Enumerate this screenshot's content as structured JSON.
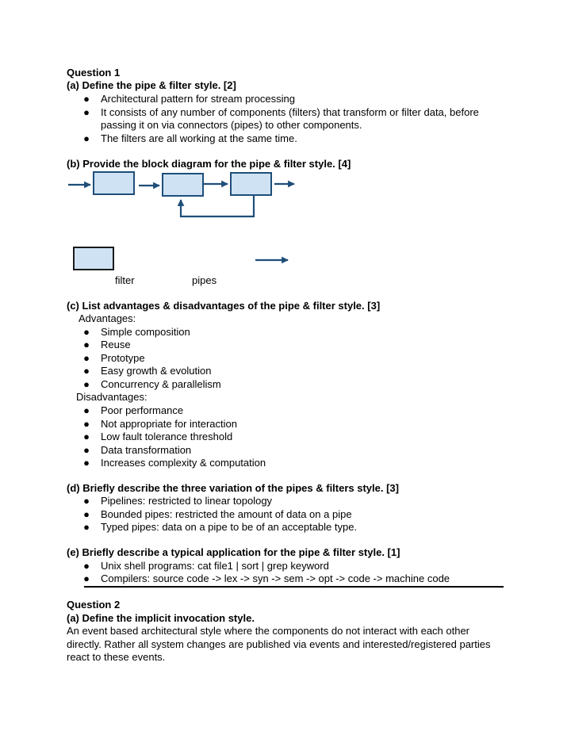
{
  "q1": {
    "title": "Question 1",
    "a": {
      "heading": "(a) Define the pipe & filter style. [2]",
      "bullets": [
        "Architectural pattern for stream processing",
        "It consists of any number of components (filters) that transform or filter data, before",
        "The filters are all working at the same time."
      ],
      "bullet2_cont": "passing it on via connectors (pipes) to other components."
    },
    "b": {
      "heading": "(b) Provide the block diagram for the pipe & filter style. [4]",
      "legend_filter": "filter",
      "legend_pipes": "pipes",
      "colors": {
        "box_fill": "#cfe2f3",
        "box_stroke": "#1f4e79",
        "arrow": "#1f4e79",
        "legend_stroke": "#000000"
      }
    },
    "c": {
      "heading": "(c) List advantages & disadvantages of the pipe & filter style. [3]",
      "advantages_label": "Advantages:",
      "advantages": [
        "Simple composition",
        "Reuse",
        "Prototype",
        "Easy growth & evolution",
        "Concurrency & parallelism"
      ],
      "disadvantages_label": "Disadvantages:",
      "disadvantages": [
        "Poor performance",
        "Not appropriate for interaction",
        "Low fault tolerance threshold",
        "Data transformation",
        "Increases complexity & computation"
      ]
    },
    "d": {
      "heading": "(d) Briefly describe the three variation of the pipes & filters style. [3]",
      "bullets": [
        "Pipelines: restricted to linear topology",
        "Bounded pipes: restricted the amount of data on a pipe",
        "Typed pipes: data on a pipe to be of an acceptable type."
      ]
    },
    "e": {
      "heading": "(e) Briefly describe a typical application for the pipe & filter style. [1]",
      "bullets": [
        "Unix shell programs: cat file1 | sort | grep keyword",
        "Compilers: source code -> lex -> syn -> sem -> opt -> code -> machine code"
      ]
    }
  },
  "q2": {
    "title": "Question 2",
    "a": {
      "heading": "(a) Define the implicit invocation style.",
      "lines": [
        "An event based architectural style where the components do not interact with each other",
        "directly.  Rather all system changes are published via events and interested/registered parties",
        "react to these events."
      ]
    }
  },
  "bullet_glyph": "●"
}
